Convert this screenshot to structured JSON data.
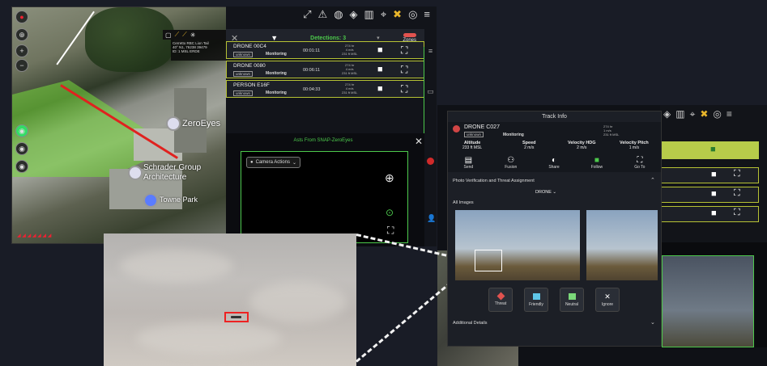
{
  "map": {
    "labels": {
      "zeroeyes": "ZeroEyes",
      "schrader": "Schrader Group",
      "architecture": "Architecture",
      "towne_park": "Towne Park"
    },
    "infobox": [
      "Cerretto RBC Lion Tail",
      "40° N1, 76238 39479",
      "ID: 1 MSL ERDE"
    ],
    "redtext": "◢ ◢ ◢ ◢ ◢ ◢ ◢"
  },
  "detections": {
    "count_label": "Detections: 3",
    "zones_label": "Zones",
    "rows": [
      {
        "name": "DRONE 00C4",
        "tag": "unknown",
        "status": "Monitoring",
        "time": "00:01:11",
        "meta": [
          "274 hr",
          "4 m/s",
          "231 ft MSL"
        ]
      },
      {
        "name": "DRONE 0080",
        "tag": "unknown",
        "status": "Monitoring",
        "time": "00:06:11",
        "meta": [
          "274 hr",
          "4 m/s",
          "231 ft MSL"
        ]
      },
      {
        "name": "PERSON E16F",
        "tag": "unknown",
        "status": "Monitoring",
        "time": "00:04:33",
        "meta": [
          "274 hr",
          "4 m/s",
          "231 ft MSL"
        ]
      }
    ]
  },
  "alert": {
    "title": "Asts From SNAP-ZeroEyes",
    "camera_actions": "Camera Actions"
  },
  "track": {
    "title": "Track Info",
    "name": "DRONE C027",
    "tag": "unknown",
    "status": "Monitoring",
    "tiny": [
      "274 hr",
      "1 m/s",
      "231 ft MSL"
    ],
    "stats": [
      {
        "label": "Altitude",
        "value": "233 ft MSL"
      },
      {
        "label": "Speed",
        "value": "2 m/s"
      },
      {
        "label": "Velocity HDG",
        "value": "2 m/s"
      },
      {
        "label": "Velocity Pitch",
        "value": "1 m/s"
      }
    ],
    "actions": [
      "Send",
      "Fusion",
      "Share",
      "Follow",
      "Go To"
    ],
    "photo_section": "Photo Verification and Threat Assignment",
    "class_select": "DRONE",
    "images_label": "All Images",
    "assign": [
      {
        "label": "Threat",
        "color": "#e0524f"
      },
      {
        "label": "Friendly",
        "color": "#5fc6e8"
      },
      {
        "label": "Neutral",
        "color": "#7bd97a"
      },
      {
        "label": "Ignore",
        "color": "#ffffff"
      }
    ],
    "additional": "Additional Details"
  }
}
